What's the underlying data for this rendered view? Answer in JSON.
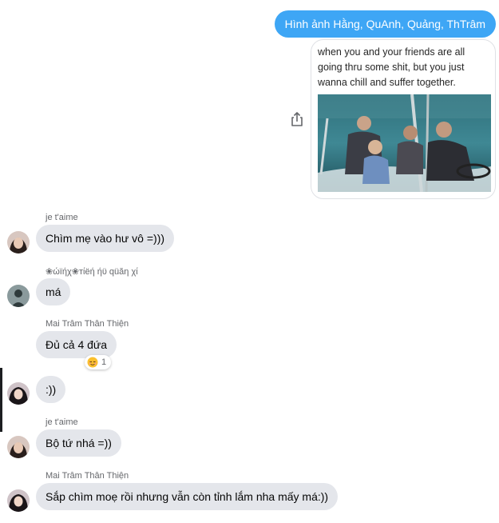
{
  "sent": {
    "message": "Hình ảnh Hằng, QuAnh, Quảng, ThTrâm",
    "meme_caption": "when you and your friends are all going thru some shit, but you just wanna chill and suffer together.",
    "bubble_color": "#3ea6f5"
  },
  "messages": [
    {
      "sender": "je t'aime",
      "text": "Chìm mẹ vào hư vô =)))"
    },
    {
      "sender": "❀ώïήχ❀тίëή ήϋ qüăη χί",
      "text": "má"
    },
    {
      "sender": "Mai Trâm Thân Thiện",
      "text": "Đủ cả 4 đứa",
      "reaction": {
        "icon": "relieved-face-emoji",
        "count": "1"
      }
    },
    {
      "sender": "",
      "text": ":))"
    },
    {
      "sender": "je t'aime",
      "text": "Bộ tứ nhá =))"
    },
    {
      "sender": "Mai Trâm Thân Thiện",
      "text": "Sắp chìm moẹ rồi nhưng vẫn còn tỉnh lắm nha mấy má:))"
    }
  ],
  "colors": {
    "received_bubble": "#e4e6eb",
    "sender_label": "#65676b"
  },
  "icons": {
    "share": "share-icon"
  }
}
